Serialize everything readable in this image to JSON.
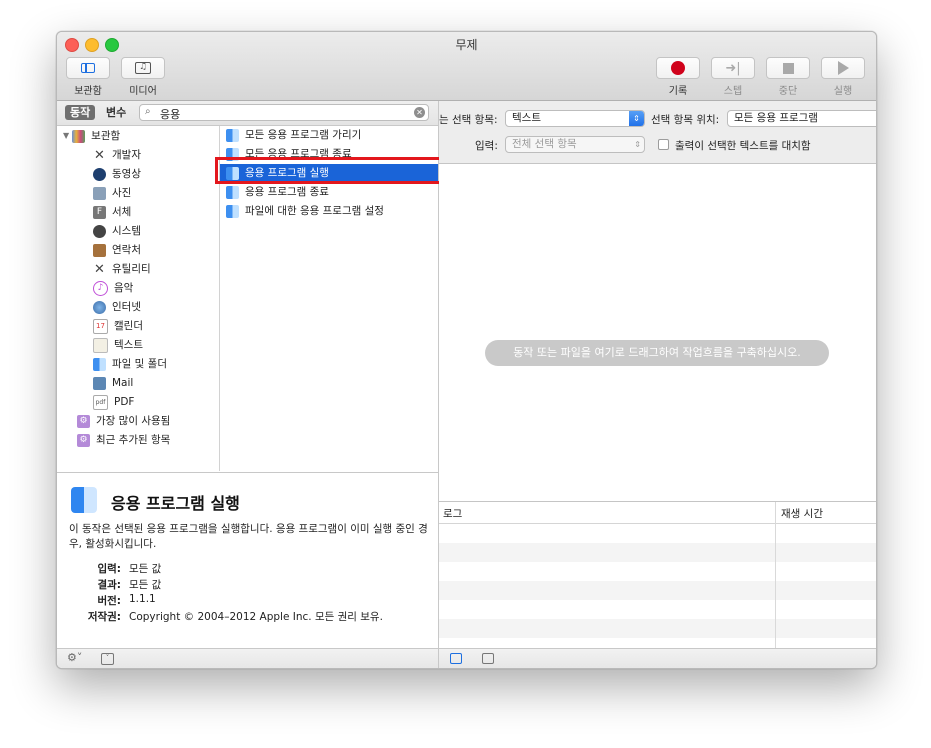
{
  "window": {
    "title": "무제"
  },
  "toolbar": {
    "library_label": "보관함",
    "media_label": "미디어",
    "record_label": "기록",
    "step_label": "스텝",
    "stop_label": "중단",
    "run_label": "실행"
  },
  "search": {
    "tab_actions": "동작",
    "tab_variables": "변수",
    "value": "응용"
  },
  "library": {
    "root": "보관함",
    "items": [
      "개발자",
      "동영상",
      "사진",
      "서체",
      "시스템",
      "연락처",
      "유틸리티",
      "음악",
      "인터넷",
      "캘린더",
      "텍스트",
      "파일 및 폴더",
      "Mail",
      "PDF"
    ],
    "smart": [
      "가장 많이 사용됨",
      "최근 추가된 항목"
    ]
  },
  "actions": {
    "items": [
      "모든 응용 프로그램 가리기",
      "모든 응용 프로그램 종료",
      "응용 프로그램 실행",
      "응용 프로그램 종료",
      "파일에 대한 응용 프로그램 설정"
    ],
    "selected_index": 2
  },
  "description": {
    "title": "응용 프로그램 실행",
    "text": "이 동작은 선택된 응용 프로그램을 실행합니다. 응용 프로그램이 이미 실행 중인 경우, 활성화시킵니다.",
    "input_key": "입력:",
    "input_val": "모든 값",
    "result_key": "결과:",
    "result_val": "모든 값",
    "version_key": "버전:",
    "version_val": "1.1.1",
    "copyright_key": "저작권:",
    "copyright_val": "Copyright © 2004–2012 Apple Inc.  모든 권리 보유."
  },
  "workflow": {
    "receives_label": "는 선택 항목:",
    "receives_value": "텍스트",
    "location_label": "선택 항목 위치:",
    "location_value": "모든 응용 프로그램",
    "input_label": "입력:",
    "input_value": "전체 선택 항목",
    "replace_label": "출력이 선택한 텍스트를 대치함",
    "hint": "동작 또는 파일을 여기로 드래그하여 작업흐름을 구축하십시오."
  },
  "log": {
    "col_log": "로그",
    "col_duration": "재생 시간"
  },
  "colors": {
    "selection": "#1a64d8",
    "record": "#d0021b",
    "annotation": "#e3171d"
  }
}
